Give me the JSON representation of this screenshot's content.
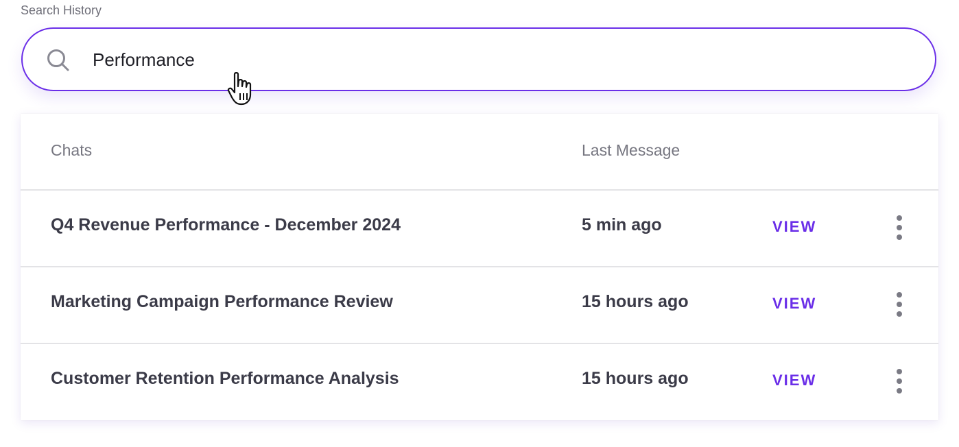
{
  "search": {
    "label": "Search History",
    "value": "Performance",
    "icon": "search-icon"
  },
  "table": {
    "headers": {
      "chats": "Chats",
      "last_message": "Last Message"
    },
    "rows": [
      {
        "title": "Q4 Revenue Performance - December 2024",
        "time": "5 min ago",
        "action": "VIEW"
      },
      {
        "title": "Marketing Campaign Performance Review",
        "time": "15 hours ago",
        "action": "VIEW"
      },
      {
        "title": "Customer Retention Performance Analysis",
        "time": "15 hours ago",
        "action": "VIEW"
      }
    ]
  },
  "colors": {
    "accent": "#6a2ee8",
    "text": "#3b3b48",
    "muted": "#767680",
    "divider": "#e3e3e6"
  }
}
